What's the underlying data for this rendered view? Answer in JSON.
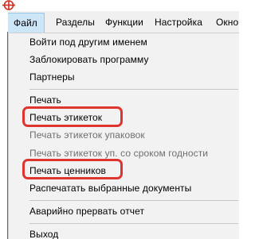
{
  "menubar": {
    "items": [
      {
        "label": "Файл",
        "active": true
      },
      {
        "label": "Разделы",
        "active": false
      },
      {
        "label": "Функции",
        "active": false
      },
      {
        "label": "Настройка",
        "active": false
      },
      {
        "label": "Окно",
        "active": false
      }
    ]
  },
  "file_menu": {
    "items": [
      {
        "label": "Войти под другим именем",
        "enabled": true
      },
      {
        "label": "Заблокировать программу",
        "enabled": true
      },
      {
        "label": "Партнеры",
        "enabled": true
      },
      {
        "label": "Печать",
        "enabled": true
      },
      {
        "label": "Печать этикеток",
        "enabled": true,
        "highlighted": true
      },
      {
        "label": "Печать этикеток упаковок",
        "enabled": false
      },
      {
        "label": "Печать этикеток уп. со сроком годности",
        "enabled": false
      },
      {
        "label": "Печать ценников",
        "enabled": true,
        "highlighted": true
      },
      {
        "label": "Распечатать выбранные документы",
        "enabled": true
      },
      {
        "label": "Аварийно прервать отчет",
        "enabled": true
      },
      {
        "label": "Выход",
        "enabled": true
      }
    ]
  },
  "colors": {
    "highlight_border": "#e0342e",
    "active_tab_bg": "#cde6f7",
    "menu_bg": "#f2f2f2",
    "disabled_text": "#6f6f6f"
  }
}
